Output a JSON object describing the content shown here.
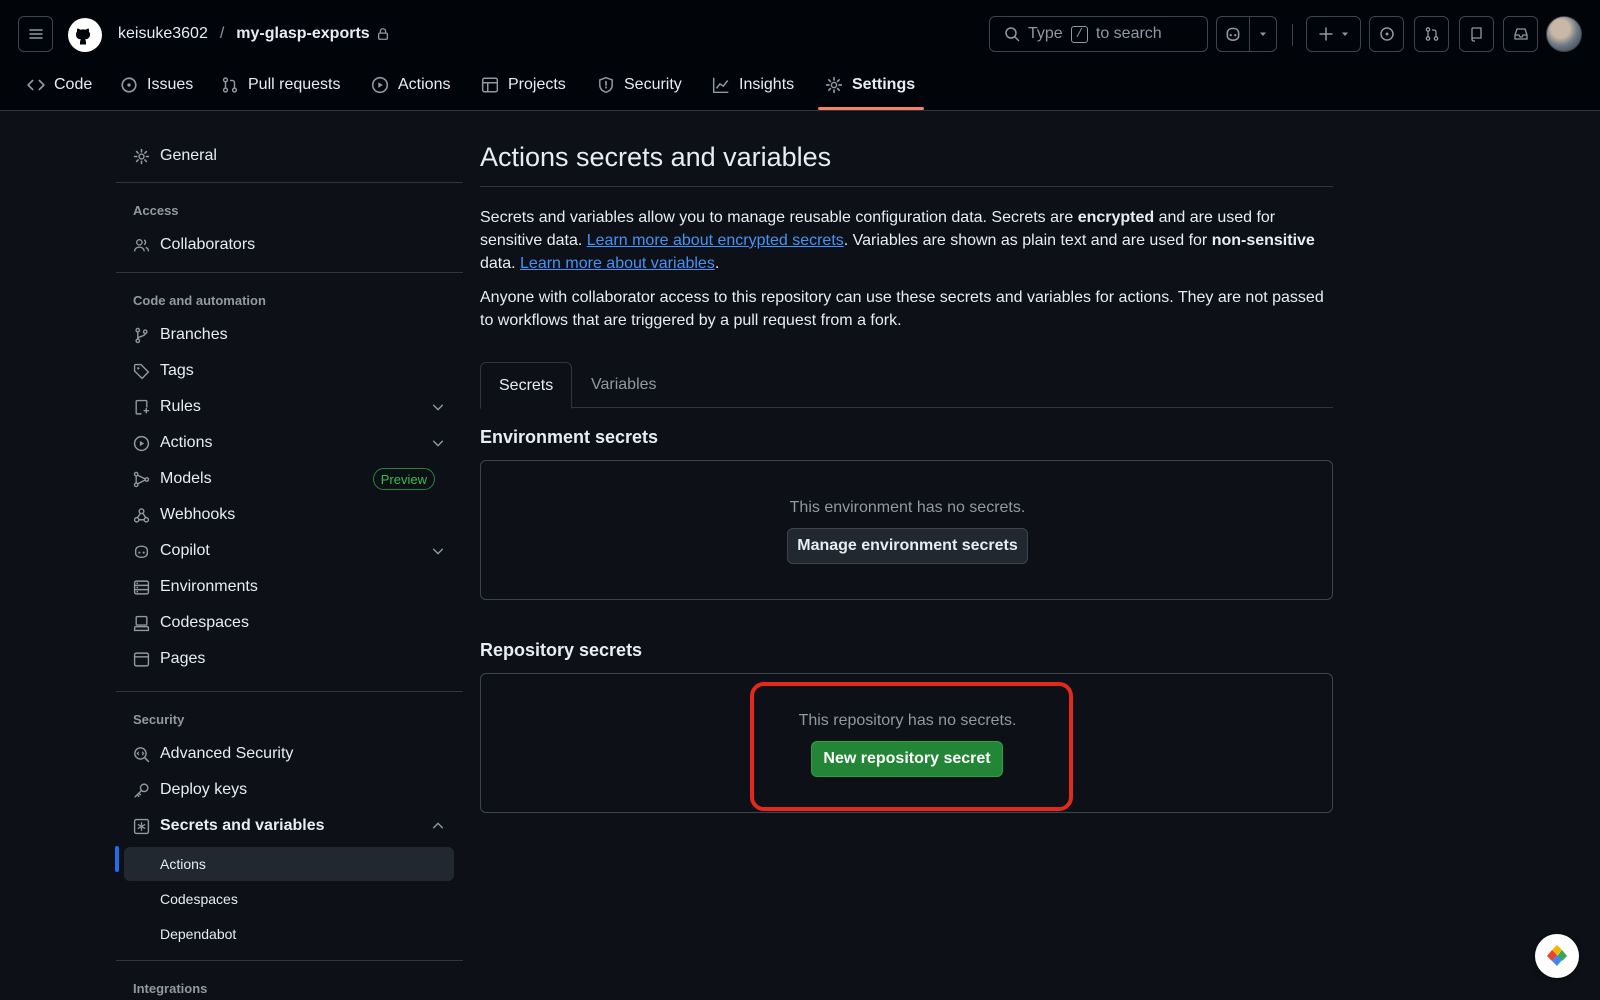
{
  "header": {
    "owner": "keisuke3602",
    "separator": "/",
    "repo": "my-glasp-exports",
    "search": {
      "prefix": "Type",
      "key": "/",
      "suffix": "to search"
    }
  },
  "repo_nav": [
    {
      "label": "Code",
      "icon": "code-icon"
    },
    {
      "label": "Issues",
      "icon": "issue-icon"
    },
    {
      "label": "Pull requests",
      "icon": "pull-request-icon"
    },
    {
      "label": "Actions",
      "icon": "play-icon"
    },
    {
      "label": "Projects",
      "icon": "table-icon"
    },
    {
      "label": "Security",
      "icon": "shield-icon"
    },
    {
      "label": "Insights",
      "icon": "graph-icon"
    },
    {
      "label": "Settings",
      "icon": "gear-icon",
      "active": true
    }
  ],
  "sidebar": {
    "general": "General",
    "access_heading": "Access",
    "collaborators": "Collaborators",
    "code_heading": "Code and automation",
    "code_items": [
      "Branches",
      "Tags",
      "Rules",
      "Actions",
      "Models",
      "Webhooks",
      "Copilot",
      "Environments",
      "Codespaces",
      "Pages"
    ],
    "models_badge": "Preview",
    "security_heading": "Security",
    "security_items": [
      "Advanced Security",
      "Deploy keys",
      "Secrets and variables"
    ],
    "secrets_subitems": [
      "Actions",
      "Codespaces",
      "Dependabot"
    ],
    "integrations_heading": "Integrations"
  },
  "main": {
    "title": "Actions secrets and variables",
    "intro": {
      "t1": "Secrets and variables allow you to manage reusable configuration data. Secrets are ",
      "b1": "encrypted",
      "t2": " and are used for sensitive data. ",
      "link1": "Learn more about encrypted secrets",
      "t3": ". Variables are shown as plain text and are used for ",
      "b2": "non-sensitive",
      "t4": " data. ",
      "link2": "Learn more about variables",
      "t5": "."
    },
    "note": "Anyone with collaborator access to this repository can use these secrets and variables for actions. They are not passed to workflows that are triggered by a pull request from a fork.",
    "tabs": [
      "Secrets",
      "Variables"
    ],
    "env_heading": "Environment secrets",
    "env_empty": "This environment has no secrets.",
    "env_button": "Manage environment secrets",
    "repo_heading": "Repository secrets",
    "repo_empty": "This repository has no secrets.",
    "repo_button": "New repository secret"
  },
  "colors": {
    "accent_underline": "#f78166",
    "primary_button": "#238636",
    "highlight": "#e5281c",
    "link": "#4493f8"
  }
}
